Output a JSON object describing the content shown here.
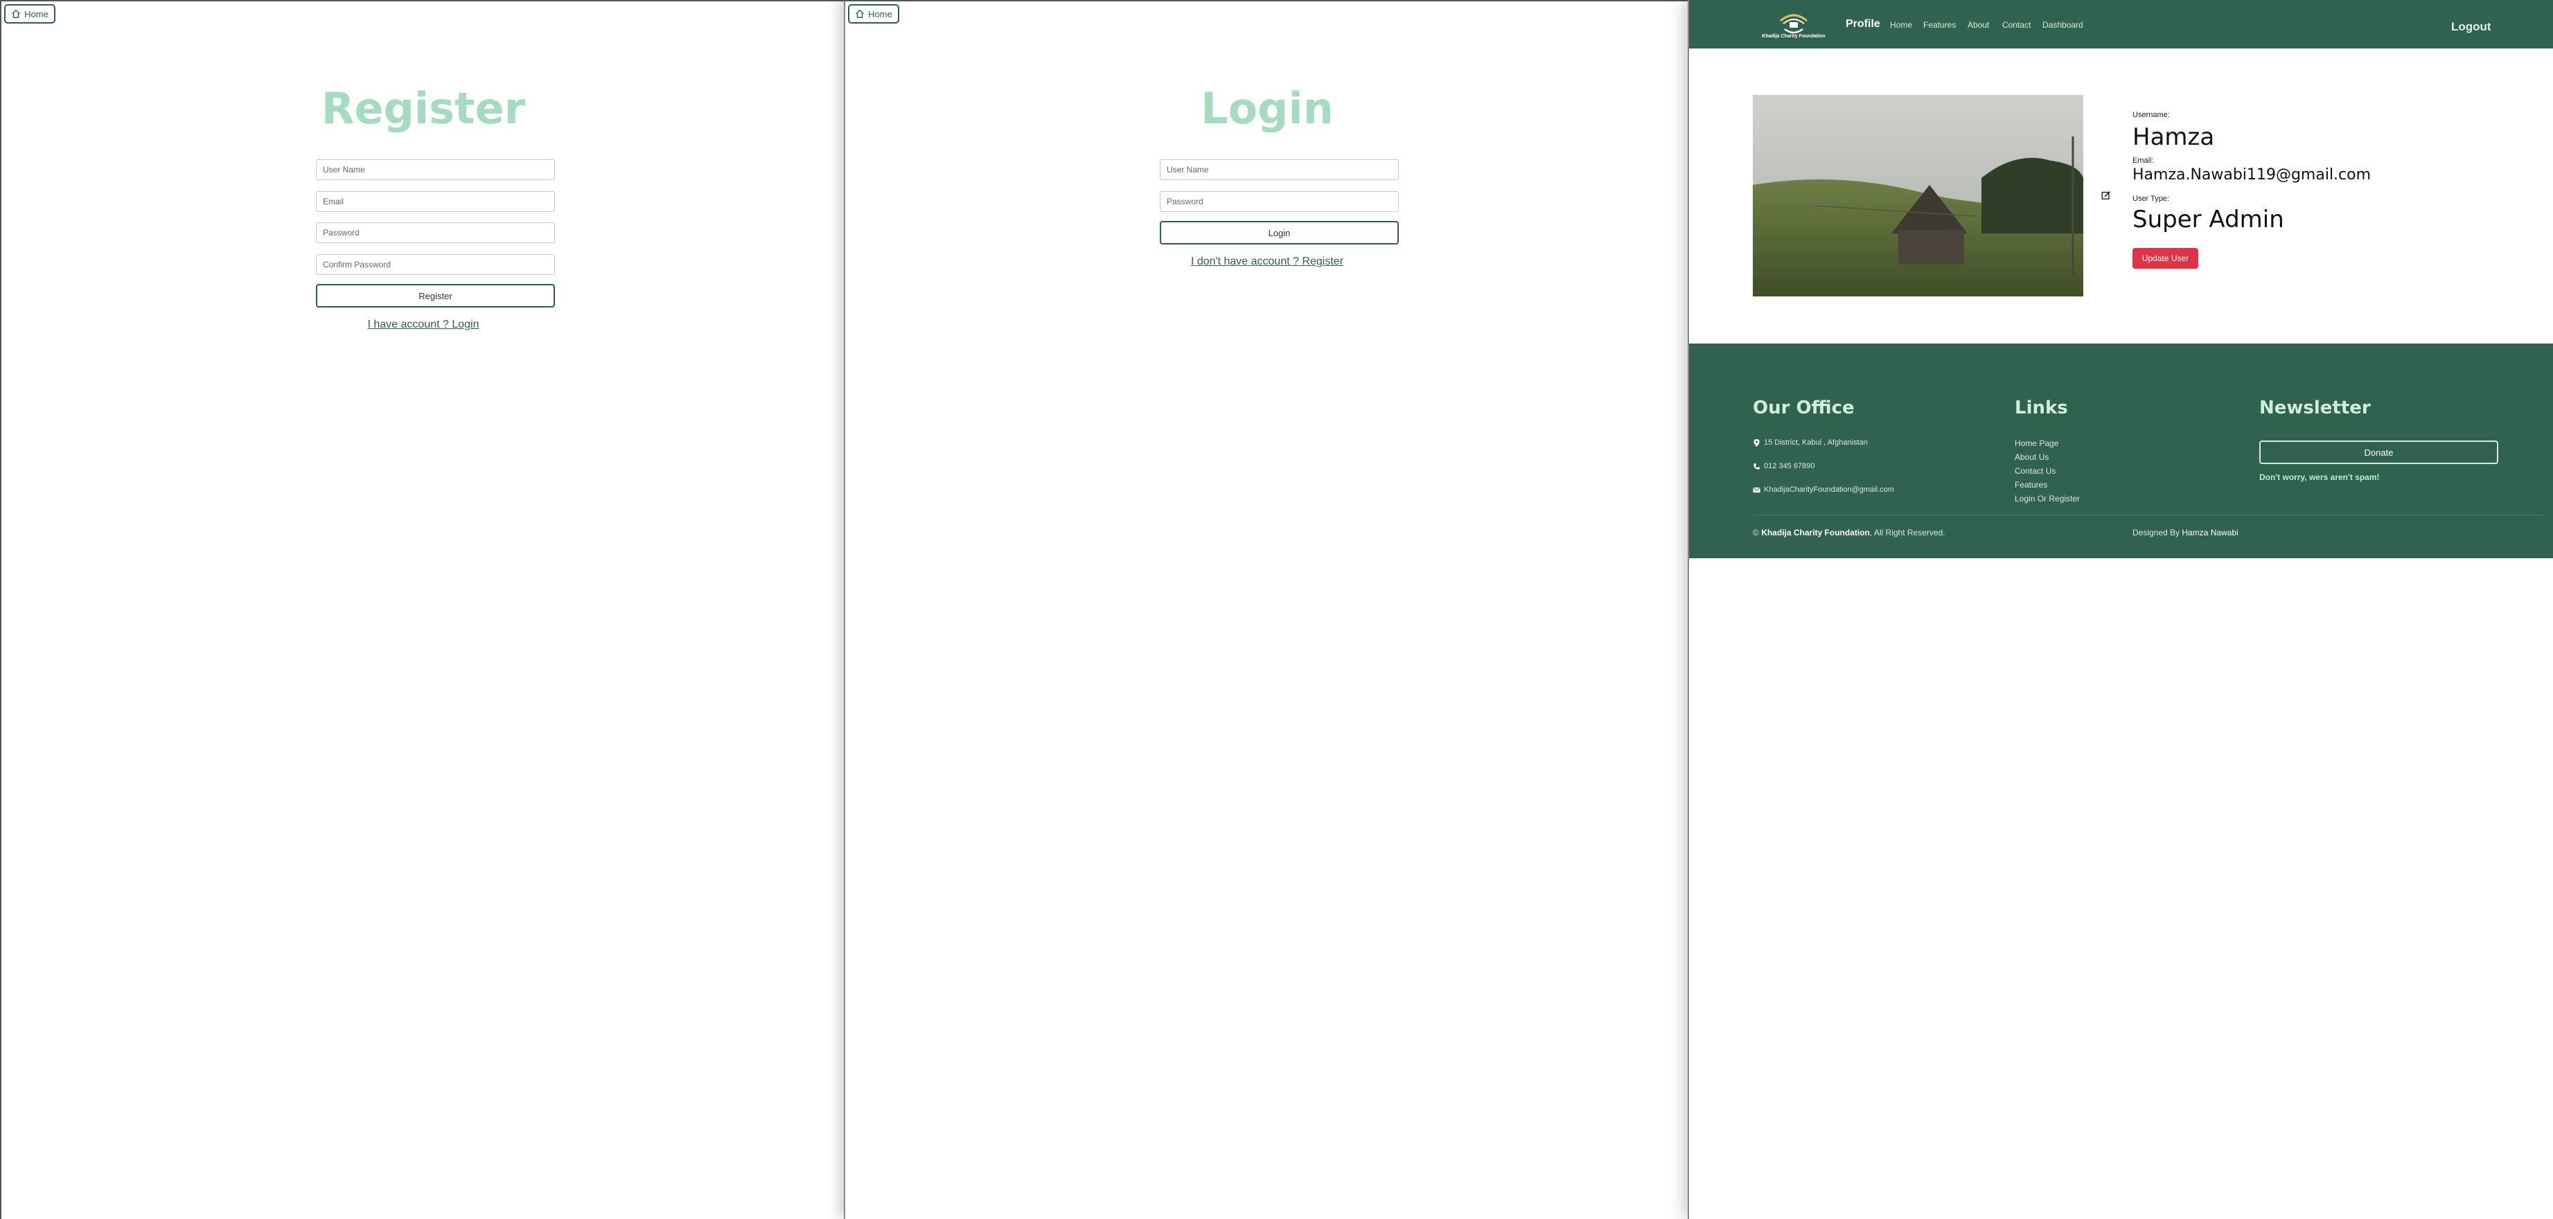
{
  "register": {
    "home_label": "Home",
    "title": "Register",
    "username_placeholder": "User Name",
    "email_placeholder": "Email",
    "password_placeholder": "Password",
    "confirm_placeholder": "Confirm Password",
    "submit_label": "Register",
    "switch_link": "I have account ? Login"
  },
  "login": {
    "home_label": "Home",
    "title": "Login",
    "username_placeholder": "User Name",
    "password_placeholder": "Password",
    "submit_label": "Login",
    "switch_link": "I don't have account ? Register"
  },
  "profile": {
    "brand": "Khadija Charity Foundation",
    "nav": {
      "active": "Profile",
      "items": [
        "Home",
        "Features",
        "About",
        "Contact",
        "Dashboard"
      ],
      "logout": "Logout"
    },
    "username_label": "Username:",
    "username": "Hamza",
    "email_label": "Email:",
    "email": "Hamza.Nawabi119@gmail.com",
    "usertype_label": "User Type:",
    "usertype": "Super Admin",
    "update_label": "Update User"
  },
  "footer": {
    "office_title": "Our Office",
    "address": "15 District, Kabul , Afghanistan",
    "phone": "012 345 67890",
    "email": "KhadijaCharityFoundation@gmail.com",
    "links_title": "Links",
    "links": [
      "Home Page",
      "About Us",
      "Contact Us",
      "Features",
      "Login Or Register"
    ],
    "newsletter_title": "Newsletter",
    "donate_label": "Donate",
    "spam_note": "Don't worry, wers aren't spam!",
    "copyright_symbol": "©",
    "copyright_name": "Khadija Charity Foundation",
    "copyright_rest": ", All Right Reserved.",
    "designed_label": "Designed By",
    "designer": "Hamza Nawabi"
  },
  "colors": {
    "primary": "#31614f",
    "title_green": "#a5dcc0",
    "danger": "#dc3545",
    "accent": "#b8f0cf"
  }
}
